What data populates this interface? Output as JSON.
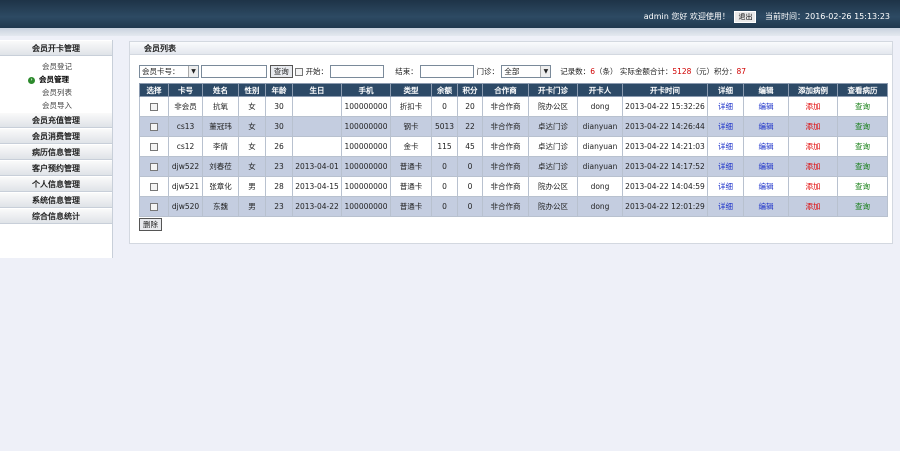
{
  "header": {
    "user": "admin",
    "welcome": "您好 欢迎使用！",
    "logout": "退出",
    "time_label": "当前时间：",
    "time": "2016-02-26 15:13:23"
  },
  "sidebar": {
    "sections": [
      {
        "label": "会员开卡管理"
      },
      {
        "label": "会员充值管理"
      },
      {
        "label": "会员消费管理"
      },
      {
        "label": "病历信息管理"
      },
      {
        "label": "客户预约管理"
      },
      {
        "label": "个人信息管理"
      },
      {
        "label": "系统信息管理"
      },
      {
        "label": "综合信息统计"
      }
    ],
    "sub_items": [
      "会员登记",
      "会员管理",
      "会员列表",
      "会员导入"
    ]
  },
  "panel": {
    "title": "会员列表"
  },
  "filters": {
    "field_select": "会员卡号：",
    "search_button": "查询",
    "start_label": "开始：",
    "end_label": "结束：",
    "clinic_label": "门诊：",
    "clinic_select": "全部",
    "record_label": "记录数：",
    "record_count": "6",
    "record_unit": "（条）",
    "amount_label": "实际金额合计：",
    "amount": "5128",
    "amount_unit": "（元）",
    "points_label": "积分：",
    "points": "87"
  },
  "table": {
    "headers": [
      "选择",
      "卡号",
      "姓名",
      "性别",
      "年龄",
      "生日",
      "手机",
      "类型",
      "余额",
      "积分",
      "合作商",
      "开卡门诊",
      "开卡人",
      "开卡时间",
      "详细",
      "编辑",
      "添加病例",
      "查看病历"
    ],
    "rows": [
      [
        "非会员",
        "抗氧",
        "女",
        "30",
        "",
        "100000000",
        "折扣卡",
        "0",
        "20",
        "非合作商",
        "院办公区",
        "dong",
        "2013-04-22 15:32:26"
      ],
      [
        "cs13",
        "董冠玮",
        "女",
        "30",
        "",
        "100000000",
        "钢卡",
        "5013",
        "22",
        "非合作商",
        "卓达门诊",
        "dianyuan",
        "2013-04-22 14:26:44"
      ],
      [
        "cs12",
        "李倩",
        "女",
        "26",
        "",
        "100000000",
        "金卡",
        "115",
        "45",
        "非合作商",
        "卓达门诊",
        "dianyuan",
        "2013-04-22 14:21:03"
      ],
      [
        "djw522",
        "刘春莅",
        "女",
        "23",
        "2013-04-01",
        "100000000",
        "普通卡",
        "0",
        "0",
        "非合作商",
        "卓达门诊",
        "dianyuan",
        "2013-04-22 14:17:52"
      ],
      [
        "djw521",
        "张章化",
        "男",
        "28",
        "2013-04-15",
        "100000000",
        "普通卡",
        "0",
        "0",
        "非合作商",
        "院办公区",
        "dong",
        "2013-04-22 14:04:59"
      ],
      [
        "djw520",
        "东魏",
        "男",
        "23",
        "2013-04-22",
        "100000000",
        "普通卡",
        "0",
        "0",
        "非合作商",
        "院办公区",
        "dong",
        "2013-04-22 12:01:29"
      ]
    ],
    "link_detail": "详细",
    "link_edit": "编辑",
    "link_add_case": "添加",
    "link_view_case": "查询"
  },
  "delete_button": "删除"
}
